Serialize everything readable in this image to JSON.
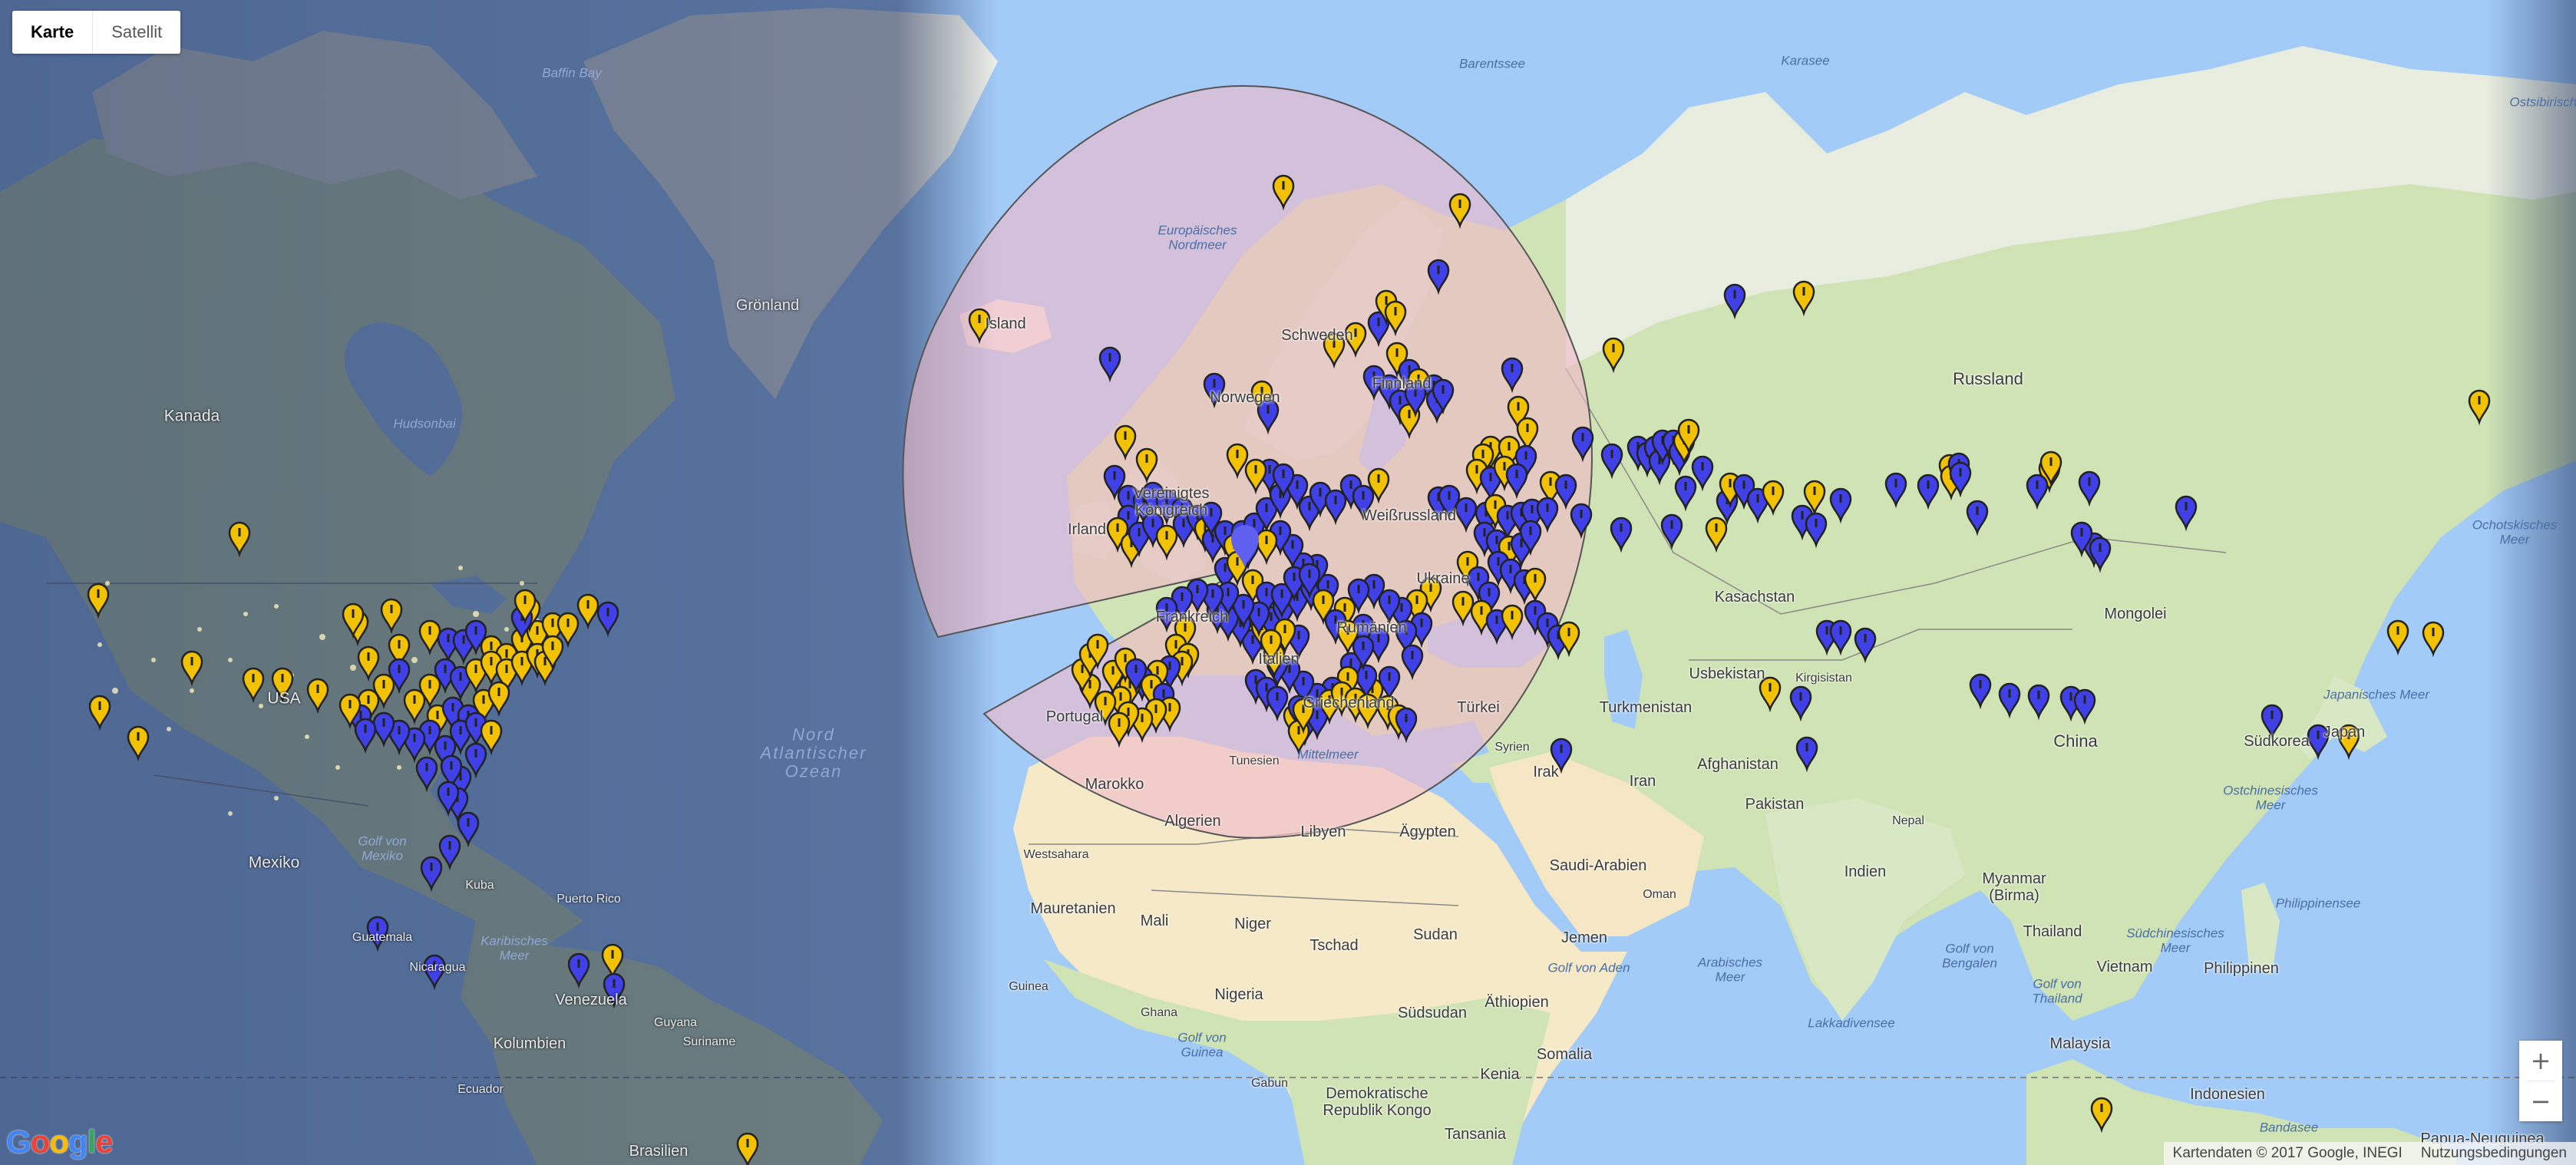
{
  "map_type_control": {
    "map_label": "Karte",
    "satellite_label": "Satellit",
    "selected": "Karte"
  },
  "zoom": {
    "in_label": "+",
    "out_label": "−"
  },
  "footer": {
    "attribution": "Kartendaten © 2017 Google, INEGI",
    "terms": "Nutzungsbedingungen"
  },
  "logo": {
    "text": "Google"
  },
  "colors": {
    "ocean": "#a3cbf8",
    "land": "#eef0e4",
    "vegetation": "#c9e3ac",
    "desert": "#f5e6c4",
    "night_overlay": "#1a2a55",
    "circle_fill": "#f0b9c8",
    "pin_blue": "#4040e8",
    "pin_yellow": "#f2c200"
  },
  "labels": {
    "baffin_bay": "Baffin Bay",
    "groenland": "Grönland",
    "hudsonbai": "Hudsonbai",
    "kanada": "Kanada",
    "usa": "USA",
    "nord_atlantischer_ozean": "Nord\nAtlantischer\nOzean",
    "golf_von_mexiko": "Golf von\nMexiko",
    "mexiko": "Mexiko",
    "kuba": "Kuba",
    "puerto_rico": "Puerto Rico",
    "karibisches_meer": "Karibisches\nMeer",
    "guatemala": "Guatemala",
    "nicaragua": "Nicaragua",
    "venezuela": "Venezuela",
    "suriname": "Suriname",
    "guyana": "Guyana",
    "kolumbien": "Kolumbien",
    "ecuador": "Ecuador",
    "brasilien": "Brasilien",
    "barentssee": "Barentssee",
    "karasee": "Karasee",
    "ostsibirische": "Ostsibirische",
    "europaeisches_nordmeer": "Europäisches\nNordmeer",
    "island": "Island",
    "schweden": "Schweden",
    "norwegen": "Norwegen",
    "finnland": "Finnland",
    "vereinigtes_koenigreich": "Vereinigtes\nKönigreich",
    "irland": "Irland",
    "weissrussland": "Weißrussland",
    "ukraine": "Ukraine",
    "frankreich": "Frankreich",
    "italien": "Italien",
    "portugal": "Portugal",
    "rumaenien": "Rumänien",
    "griechenland": "Griechenland",
    "tuerkei": "Türkei",
    "mittelmeer": "Mittelmeer",
    "tunesien": "Tunesien",
    "marokko": "Marokko",
    "algerien": "Algerien",
    "libyen": "Libyen",
    "aegypten": "Ägypten",
    "westsahara": "Westsahara",
    "mauretanien": "Mauretanien",
    "mali": "Mali",
    "niger": "Niger",
    "tschad": "Tschad",
    "sudan": "Sudan",
    "suedsudan": "Südsudan",
    "aethiopien": "Äthiopien",
    "somalia": "Somalia",
    "kenia": "Kenia",
    "tansania": "Tansania",
    "demokratische_republik_kongo": "Demokratische\nRepublik Kongo",
    "gabun": "Gabun",
    "nigeria": "Nigeria",
    "ghana": "Ghana",
    "guinea": "Guinea",
    "golf_von_guinea": "Golf von\nGuinea",
    "syrien": "Syrien",
    "irak": "Irak",
    "iran": "Iran",
    "saudi_arabien": "Saudi-Arabien",
    "oman": "Oman",
    "jemen": "Jemen",
    "golf_von_aden": "Golf von Aden",
    "arabisches_meer": "Arabisches\nMeer",
    "russland": "Russland",
    "kasachstan": "Kasachstan",
    "usbekistan": "Usbekistan",
    "turkmenistan": "Turkmenistan",
    "kirgisistan": "Kirgisistan",
    "afghanistan": "Afghanistan",
    "pakistan": "Pakistan",
    "nepal": "Nepal",
    "indien": "Indien",
    "china": "China",
    "mongolei": "Mongolei",
    "suedkorea": "Südkorea",
    "japan": "Japan",
    "japanisches_meer": "Japanisches Meer",
    "ostchinesisches_meer": "Ostchinesisches\nMeer",
    "ochotskisches_meer": "Ochotskisches\nMeer",
    "myanmar": "Myanmar\n(Birma)",
    "thailand": "Thailand",
    "vietnam": "Vietnam",
    "philippinen": "Philippinen",
    "philippinensee": "Philippinensee",
    "suedchinesisches_meer": "Südchinesisches\nMeer",
    "golf_von_bengalen": "Golf von\nBengalen",
    "golf_von_thailand": "Golf von\nThailand",
    "malaysia": "Malaysia",
    "indonesien": "Indonesien",
    "bandasee": "Bandasee",
    "lakkadivensee": "Lakkadivensee",
    "papua_neuguinea": "Papua-Neuguinea"
  }
}
